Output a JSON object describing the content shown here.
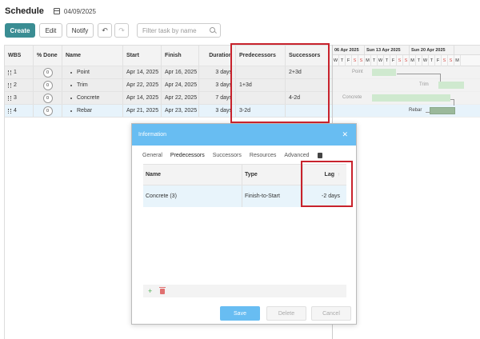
{
  "header": {
    "title": "Schedule",
    "date": "04/09/2025"
  },
  "toolbar": {
    "create_label": "Create",
    "edit_label": "Edit",
    "notify_label": "Notify",
    "search_placeholder": "Filter task by name"
  },
  "grid": {
    "columns": {
      "wbs": "WBS",
      "done": "% Done",
      "name": "Name",
      "start": "Start",
      "finish": "Finish",
      "duration": "Duration",
      "predecessors": "Predecessors",
      "successors": "Successors"
    },
    "rows": [
      {
        "wbs": "1",
        "done": "0",
        "name": "Point",
        "start": "Apr 14, 2025",
        "finish": "Apr 16, 2025",
        "duration": "3 days",
        "predecessors": "",
        "successors": "2+3d"
      },
      {
        "wbs": "2",
        "done": "0",
        "name": "Trim",
        "start": "Apr 22, 2025",
        "finish": "Apr 24, 2025",
        "duration": "3 days",
        "predecessors": "1+3d",
        "successors": ""
      },
      {
        "wbs": "3",
        "done": "0",
        "name": "Concrete",
        "start": "Apr 14, 2025",
        "finish": "Apr 22, 2025",
        "duration": "7 days",
        "predecessors": "",
        "successors": "4-2d"
      },
      {
        "wbs": "4",
        "done": "0",
        "name": "Rebar",
        "start": "Apr 21, 2025",
        "finish": "Apr 23, 2025",
        "duration": "3 days",
        "predecessors": "3-2d",
        "successors": ""
      }
    ]
  },
  "gantt": {
    "weeks": [
      "06 Apr 2025",
      "Sun 13 Apr 2025",
      "Sun 20 Apr 2025"
    ],
    "days": [
      "W",
      "T",
      "F",
      "S",
      "S",
      "M",
      "T",
      "W",
      "T",
      "F",
      "S",
      "S",
      "M",
      "T",
      "W",
      "T",
      "F",
      "S",
      "S",
      "M"
    ],
    "bar_labels": {
      "point": "Point",
      "trim": "Trim",
      "concrete": "Concrete",
      "rebar": "Rebar"
    }
  },
  "dialog": {
    "title": "Information",
    "tabs": [
      "General",
      "Predecessors",
      "Successors",
      "Resources",
      "Advanced"
    ],
    "table": {
      "headers": {
        "name": "Name",
        "type": "Type",
        "lag": "Lag"
      },
      "rows": [
        {
          "name": "Concrete (3)",
          "type": "Finish-to-Start",
          "lag": "-2 days"
        }
      ]
    },
    "buttons": {
      "save": "Save",
      "delete": "Delete",
      "cancel": "Cancel"
    }
  },
  "colors": {
    "accent": "#3a8d93",
    "dialog_header": "#68bdf2",
    "highlight": "#c8222c"
  }
}
